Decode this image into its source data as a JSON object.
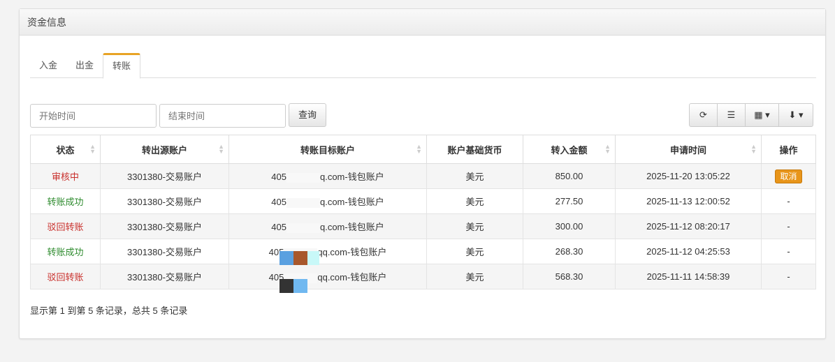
{
  "panel": {
    "title": "资金信息"
  },
  "tabs": [
    {
      "label": "入金"
    },
    {
      "label": "出金"
    },
    {
      "label": "转账",
      "active": true
    }
  ],
  "filters": {
    "start_placeholder": "开始时间",
    "end_placeholder": "结束时间",
    "query_label": "查询"
  },
  "toolbar": {
    "icons": [
      "refresh-icon",
      "list-icon",
      "columns-icon",
      "export-icon"
    ]
  },
  "table": {
    "headers": [
      "状态",
      "转出源账户",
      "转账目标账户",
      "账户基础货币",
      "转入金额",
      "申请时间",
      "操作"
    ],
    "rows": [
      {
        "status": "审核中",
        "status_color": "#c9302c",
        "source": "3301380-交易账户",
        "target_prefix": "405",
        "target_suffix": "q.com-钱包账户",
        "currency": "美元",
        "amount": "850.00",
        "time": "2025-11-20 13:05:22",
        "action": "取消"
      },
      {
        "status": "转账成功",
        "status_color": "#2e8b2e",
        "source": "3301380-交易账户",
        "target_prefix": "405",
        "target_suffix": "q.com-钱包账户",
        "currency": "美元",
        "amount": "277.50",
        "time": "2025-11-13 12:00:52",
        "action": "-"
      },
      {
        "status": "驳回转账",
        "status_color": "#c9302c",
        "source": "3301380-交易账户",
        "target_prefix": "405",
        "target_suffix": "q.com-钱包账户",
        "currency": "美元",
        "amount": "300.00",
        "time": "2025-11-12 08:20:17",
        "action": "-"
      },
      {
        "status": "转账成功",
        "status_color": "#2e8b2e",
        "source": "3301380-交易账户",
        "target_prefix": "405",
        "target_suffix": "qq.com-钱包账户",
        "currency": "美元",
        "amount": "268.30",
        "time": "2025-11-12 04:25:53",
        "action": "-"
      },
      {
        "status": "驳回转账",
        "status_color": "#c9302c",
        "source": "3301380-交易账户",
        "target_prefix": "405",
        "target_suffix": "qq.com-钱包账户",
        "currency": "美元",
        "amount": "568.30",
        "time": "2025-11-11 14:58:39",
        "action": "-"
      }
    ]
  },
  "footer": {
    "summary": "显示第 1 到第 5 条记录，总共 5 条记录"
  }
}
